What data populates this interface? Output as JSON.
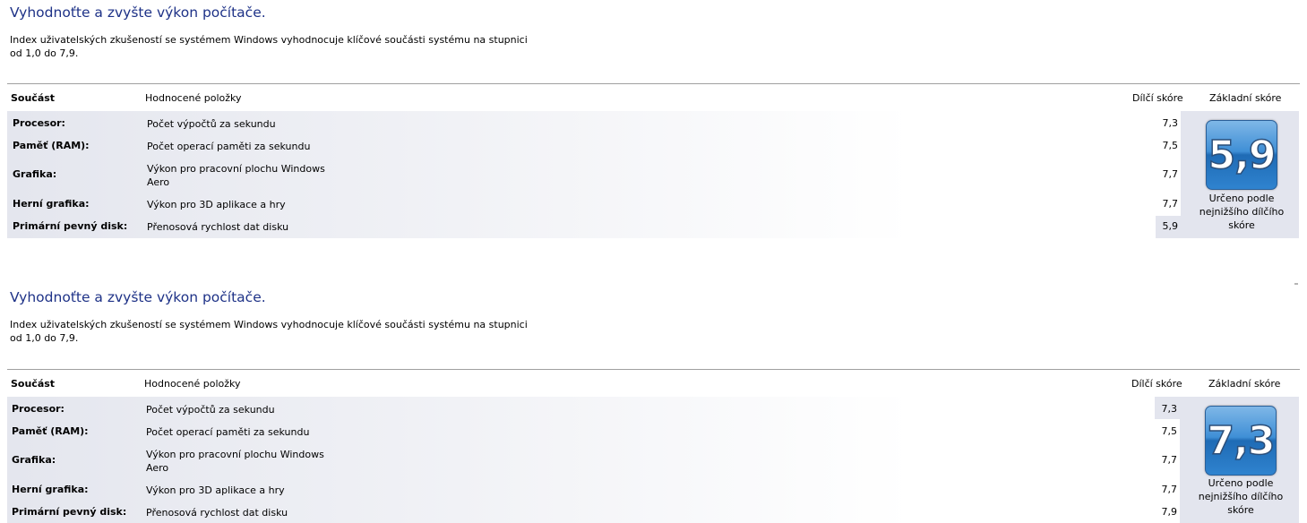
{
  "panels": [
    {
      "title": "Vyhodnoťte a zvyšte výkon počítače.",
      "description": "Index uživatelských zkušeností se systémem Windows vyhodnocuje klíčové součásti systému na stupnici od 1,0 do 7,9.",
      "headers": {
        "component": "Součást",
        "rated": "Hodnocené položky",
        "subscore": "Dílčí skóre",
        "base": "Základní skóre"
      },
      "rows": [
        {
          "component": "Procesor:",
          "rated": "Počet výpočtů za sekundu",
          "score": "7,3"
        },
        {
          "component": "Paměť (RAM):",
          "rated": "Počet operací paměti za sekundu",
          "score": "7,5"
        },
        {
          "component": "Grafika:",
          "rated": "Výkon pro pracovní plochu Windows Aero",
          "score": "7,7"
        },
        {
          "component": "Herní grafika:",
          "rated": "Výkon pro 3D aplikace a hry",
          "score": "7,7"
        },
        {
          "component": "Primární pevný disk:",
          "rated": "Přenosová rychlost dat disku",
          "score": "5,9"
        }
      ],
      "base_score": "5,9",
      "base_caption": "Určeno podle nejnižšího dílčího skóre"
    },
    {
      "title": "Vyhodnoťte a zvyšte výkon počítače.",
      "description": "Index uživatelských zkušeností se systémem Windows vyhodnocuje klíčové součásti systému na stupnici od 1,0 do 7,9.",
      "headers": {
        "component": "Součást",
        "rated": "Hodnocené položky",
        "subscore": "Dílčí skóre",
        "base": "Základní skóre"
      },
      "rows": [
        {
          "component": "Procesor:",
          "rated": "Počet výpočtů za sekundu",
          "score": "7,3"
        },
        {
          "component": "Paměť (RAM):",
          "rated": "Počet operací paměti za sekundu",
          "score": "7,5"
        },
        {
          "component": "Grafika:",
          "rated": "Výkon pro pracovní plochu Windows Aero",
          "score": "7,7"
        },
        {
          "component": "Herní grafika:",
          "rated": "Výkon pro 3D aplikace a hry",
          "score": "7,7"
        },
        {
          "component": "Primární pevný disk:",
          "rated": "Přenosová rychlost dat disku",
          "score": "7,9"
        }
      ],
      "base_score": "7,3",
      "base_caption": "Určeno podle nejnižšího dílčího skóre"
    }
  ],
  "colors": {
    "title": "#1e3287",
    "badge": "#3f8fd6",
    "row_highlight": "#e3e5ee"
  }
}
